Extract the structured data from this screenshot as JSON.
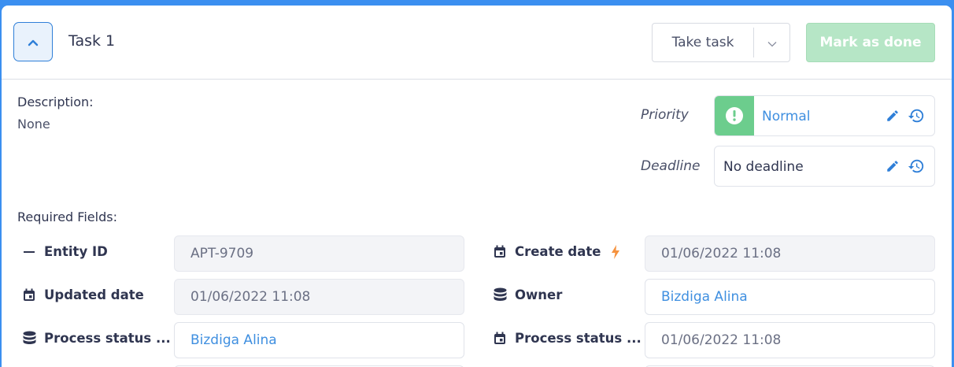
{
  "header": {
    "title": "Task 1",
    "take_task_label": "Take task",
    "mark_done_label": "Mark as done"
  },
  "description": {
    "label": "Description:",
    "value": "None"
  },
  "priority": {
    "label": "Priority",
    "value": "Normal",
    "color": "#6ccd8d"
  },
  "deadline": {
    "label": "Deadline",
    "value": "No deadline"
  },
  "required_fields": {
    "label": "Required Fields:",
    "fields": [
      {
        "label": "Entity ID",
        "icon": "dash-icon",
        "value": "APT-9709",
        "style": "readonly"
      },
      {
        "label": "Create date",
        "icon": "calendar-icon",
        "value": "01/06/2022 11:08",
        "style": "readonly",
        "extra_icon": "lightning-icon"
      },
      {
        "label": "Updated date",
        "icon": "calendar-icon",
        "value": "01/06/2022 11:08",
        "style": "readonly"
      },
      {
        "label": "Owner",
        "icon": "database-icon",
        "value": "Bizdiga Alina",
        "style": "link"
      },
      {
        "label": "Process status ...",
        "icon": "database-icon",
        "value": "Bizdiga Alina",
        "style": "link"
      },
      {
        "label": "Process status ...",
        "icon": "calendar-icon",
        "value": "01/06/2022 11:08",
        "style": "plain"
      }
    ]
  },
  "colors": {
    "accent": "#3f8fe0",
    "frame": "#3b8ff0",
    "done_button": "#b6e6c6",
    "lightning": "#f5923e"
  }
}
